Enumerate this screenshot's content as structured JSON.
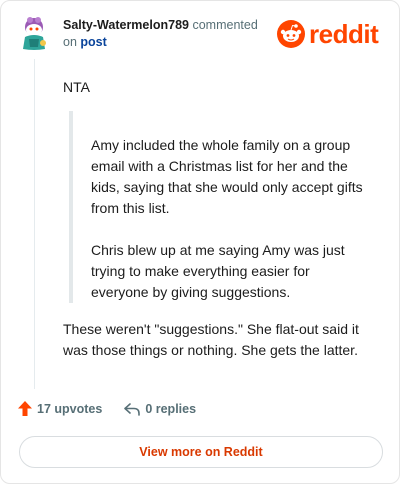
{
  "header": {
    "username": "Salty-Watermelon789",
    "action_text": "commented",
    "on_text": "on",
    "post_link": "post",
    "logo_text": "reddit"
  },
  "comment": {
    "opening": "NTA",
    "quote_paragraphs": [
      "Amy included the whole family on a group email with a Christmas list for her and the kids, saying that she would only accept gifts from this list.",
      "Chris blew up at me saying Amy was just trying to make everything easier for everyone by giving suggestions."
    ],
    "closing": "These weren't \"suggestions.\" She flat-out said it was those things or nothing. She gets the latter."
  },
  "actions": {
    "upvotes": "17 upvotes",
    "replies": "0 replies"
  },
  "footer": {
    "view_button": "View more on Reddit"
  },
  "colors": {
    "brand": "#ff4500",
    "link": "#0a449b",
    "button_text": "#d93900"
  }
}
